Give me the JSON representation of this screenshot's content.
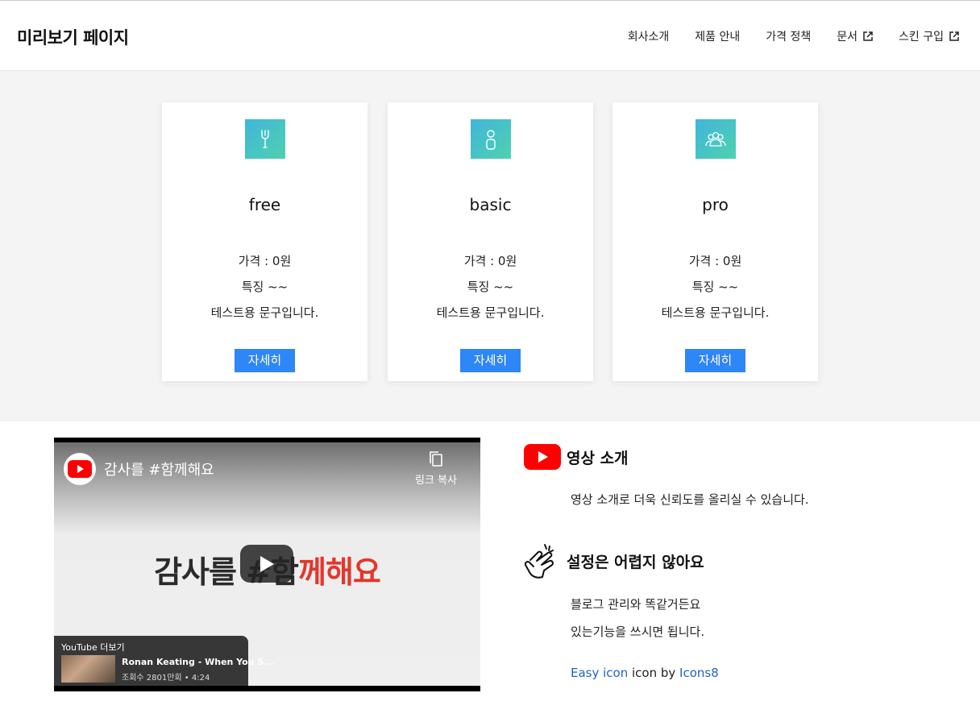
{
  "header": {
    "title": "미리보기 페이지",
    "nav": [
      {
        "label": "회사소개",
        "external": false
      },
      {
        "label": "제품 안내",
        "external": false
      },
      {
        "label": "가격 정책",
        "external": false
      },
      {
        "label": "문서",
        "external": true
      },
      {
        "label": "스킨 구입",
        "external": true
      }
    ]
  },
  "plans": [
    {
      "name": "free",
      "icon": "wrench-icon",
      "price": "가격 : 0원",
      "feature": "특징 ~~",
      "desc": "테스트용 문구입니다.",
      "button": "자세히"
    },
    {
      "name": "basic",
      "icon": "person-icon",
      "price": "가격 : 0원",
      "feature": "특징 ~~",
      "desc": "테스트용 문구입니다.",
      "button": "자세히"
    },
    {
      "name": "pro",
      "icon": "group-icon",
      "price": "가격 : 0원",
      "feature": "특징 ~~",
      "desc": "테스트용 문구입니다.",
      "button": "자세히"
    }
  ],
  "video": {
    "title": "감사를 #함께해요",
    "copy_link": "링크 복사",
    "big_text_dark": "감사를 #함",
    "big_text_red": "께해요",
    "more_label": "YouTube 더보기",
    "rec_title": "Ronan Keating - When You S...",
    "rec_meta": "조회수 2801만회 • 4:24"
  },
  "features": [
    {
      "title": "영상 소개",
      "icon": "youtube-icon",
      "lines": [
        "영상 소개로 더욱 신뢰도를 올리실 수 있습니다."
      ]
    },
    {
      "title": "설정은 어렵지 않아요",
      "icon": "snap-hand-icon",
      "lines": [
        "블로그 관리와 똑같거든요",
        "있는기능을 쓰시면 됩니다."
      ]
    }
  ],
  "credit": {
    "link1": "Easy icon",
    "middle": " icon by ",
    "link2": "Icons8"
  },
  "colors": {
    "accent": "#2f86f6",
    "icon_gradient_start": "#3fb6da",
    "icon_gradient_end": "#4fd1b0",
    "band": "#f4f4f4",
    "link": "#1f63c7",
    "youtube_red": "#ff0000"
  }
}
